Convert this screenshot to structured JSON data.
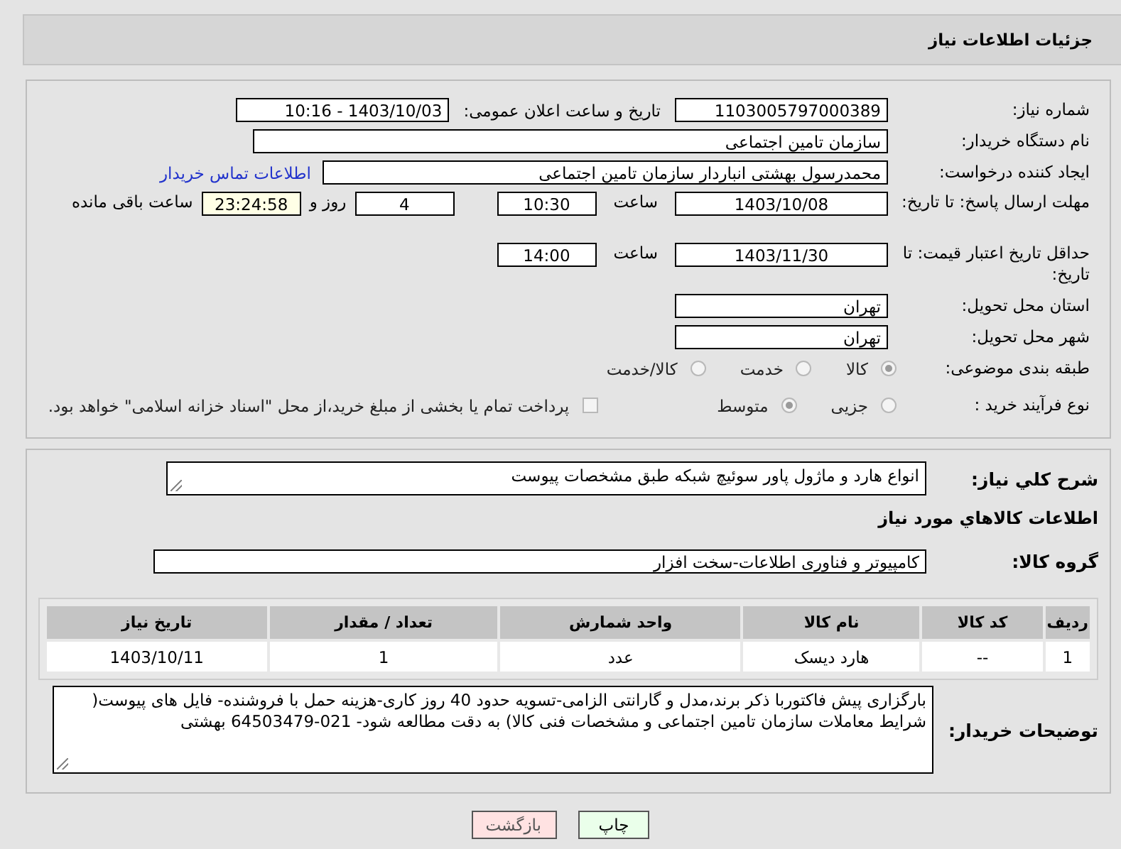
{
  "header": {
    "title": "جزئیات اطلاعات نیاز"
  },
  "need_number": {
    "label": "شماره نیاز:",
    "value": "1103005797000389"
  },
  "announcement": {
    "label": "تاریخ و ساعت اعلان عمومی:",
    "value": "1403/10/03 - 10:16"
  },
  "buyer_org": {
    "label": "نام دستگاه خریدار:",
    "value": "سازمان تامین اجتماعی"
  },
  "requester": {
    "label": "ایجاد کننده درخواست:",
    "value": "محمدرسول بهشتی انباردار سازمان تامین اجتماعی",
    "link": "اطلاعات تماس خریدار"
  },
  "reply_deadline": {
    "label": "مهلت ارسال پاسخ: تا تاریخ:",
    "date": "1403/10/08",
    "time_label": "ساعت",
    "time": "10:30",
    "days": "4",
    "days_label": "روز و",
    "remaining": "23:24:58",
    "remaining_label": "ساعت باقی مانده"
  },
  "price_validity": {
    "label": "حداقل تاریخ اعتبار قیمت: تا تاریخ:",
    "date": "1403/11/30",
    "time_label": "ساعت",
    "time": "14:00"
  },
  "province": {
    "label": "استان محل تحویل:",
    "value": "تهران"
  },
  "city": {
    "label": "شهر محل تحویل:",
    "value": "تهران"
  },
  "category": {
    "label": "طبقه بندی موضوعی:",
    "options": [
      {
        "label": "کالا",
        "selected": true
      },
      {
        "label": "خدمت",
        "selected": false
      },
      {
        "label": "کالا/خدمت",
        "selected": false
      }
    ]
  },
  "process": {
    "label": "نوع فرآیند خرید :",
    "options": [
      {
        "label": "جزیی",
        "selected": false
      },
      {
        "label": "متوسط",
        "selected": true
      }
    ],
    "checkbox": {
      "label": "پرداخت تمام یا بخشی از مبلغ خرید،از محل \"اسناد خزانه اسلامی\" خواهد بود.",
      "checked": false
    }
  },
  "description": {
    "label": "شرح کلي نياز:",
    "value": "انواع هارد و ماژول پاور سوئیچ شبکه طبق مشخصات پیوست"
  },
  "goods_title": "اطلاعات کالاهاي مورد نياز",
  "goods_group": {
    "label": "گروه کالا:",
    "value": "کامپیوتر و فناوری اطلاعات-سخت افزار"
  },
  "table": {
    "columns": [
      "رديف",
      "کد کالا",
      "نام کالا",
      "واحد شمارش",
      "تعداد / مقدار",
      "تاریخ نیاز"
    ],
    "rows": [
      [
        "1",
        "--",
        "هارد دیسک",
        "عدد",
        "1",
        "1403/10/11"
      ]
    ]
  },
  "buyer_notes": {
    "label": "توضیحات خریدار:",
    "value": "بارگزاری پیش فاکتوربا ذکر برند،مدل و گارانتی الزامی-تسویه حدود 40 روز کاری-هزینه حمل با فروشنده- فایل های پیوست( شرایط معاملات سازمان تامین اجتماعی و مشخصات فنی کالا) به دقت مطالعه شود- 021-64503479 بهشتی"
  },
  "buttons": [
    {
      "label": "چاپ",
      "kind": "print"
    },
    {
      "label": "بازگشت",
      "kind": "back"
    }
  ]
}
